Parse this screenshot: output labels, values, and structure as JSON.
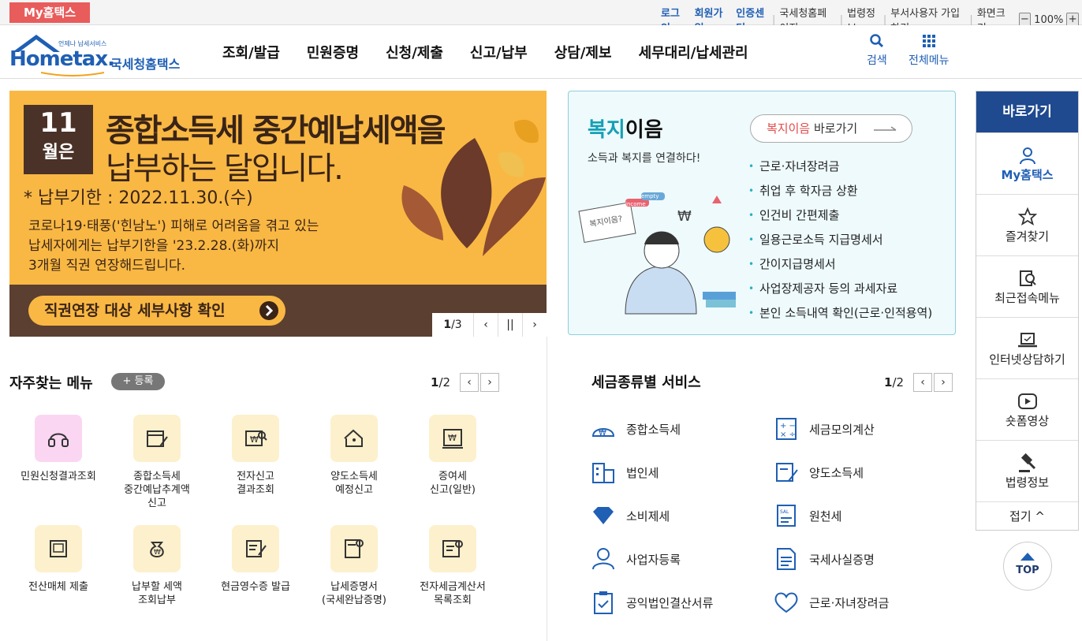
{
  "topbar": {
    "my_badge": "My홈택스",
    "links_blue": [
      "로그인",
      "회원가입",
      "인증센터"
    ],
    "links": [
      "국세청홈페이지",
      "법령정보",
      "부서사용자 가입하기"
    ],
    "zoom_label": "화면크기",
    "zoom_minus": "−",
    "zoom_value": "100%",
    "zoom_plus": "+"
  },
  "header": {
    "logo_small": "언제나 납세서비스",
    "logo_main": "Hometax.",
    "logo_kr": "국세청홈택스",
    "nav": [
      "조회/발급",
      "민원증명",
      "신청/제출",
      "신고/납부",
      "상담/제보",
      "세무대리/납세관리"
    ],
    "search_label": "검색",
    "allmenu_label": "전체메뉴"
  },
  "banner": {
    "month_num": "11",
    "month_suffix": "월은",
    "title_line1": "종합소득세 중간예납세액을",
    "title_line2": "납부하는 달입니다.",
    "due_date": "* 납부기한 : 2022.11.30.(수)",
    "desc_lines": [
      "코로나19·태풍('힌남노') 피해로 어려움을 겪고 있는",
      "납세자에게는 납부기한을 '23.2.28.(화)까지",
      "3개월 직권 연장해드립니다."
    ],
    "cta": "직권연장 대상 세부사항 확인",
    "page_current": "1",
    "page_total": "/3",
    "prev": "‹",
    "pause": "||",
    "next": "›"
  },
  "welfare": {
    "title_a": "복지",
    "title_b": "이음",
    "subtitle": "소득과 복지를 연결하다!",
    "go_a": "복지이음",
    "go_b": " 바로가기",
    "list": [
      "근로·자녀장려금",
      "취업 후 학자금 상환",
      "인건비 간편제출",
      "일용근로소득 지급명세서",
      "간이지급명세서",
      "사업장제공자 등의 과세자료",
      "본인 소득내역 확인(근로·인적용역)"
    ],
    "sign_text": "복지이음?",
    "tag1": "empty",
    "tag2": "income",
    "currency": "₩"
  },
  "favorites": {
    "title": "자주찾는 메뉴",
    "register": "+ 등록",
    "page_current": "1",
    "page_total": "/2",
    "items": [
      {
        "label": "민원신청결과조회"
      },
      {
        "label": "종합소득세\n중간예납추계액\n신고"
      },
      {
        "label": "전자신고\n결과조회"
      },
      {
        "label": "양도소득세\n예정신고"
      },
      {
        "label": "증여세\n신고(일반)"
      },
      {
        "label": "전산매체 제출"
      },
      {
        "label": "납부할 세액\n조회납부"
      },
      {
        "label": "현금영수증 발급"
      },
      {
        "label": "납세증명서\n(국세완납증명)"
      },
      {
        "label": "전자세금계산서\n목록조회"
      }
    ]
  },
  "taxservice": {
    "title": "세금종류별 서비스",
    "page_current": "1",
    "page_total": "/2",
    "items": [
      "종합소득세",
      "세금모의계산",
      "법인세",
      "양도소득세",
      "소비제세",
      "원천세",
      "사업자등록",
      "국세사실증명",
      "공익법인결산서류",
      "근로·자녀장려금"
    ]
  },
  "quick": {
    "title": "바로가기",
    "items": [
      "My홈택스",
      "즐겨찾기",
      "최근접속메뉴",
      "인터넷상담하기",
      "숏폼영상",
      "법령정보"
    ],
    "fold": "접기 ^",
    "top": "TOP"
  },
  "colors": {
    "accent": "#1f5fb4",
    "banner_bg": "#f9b843",
    "banner_dark": "#5b3f31",
    "welfare_bg": "#eefafc",
    "quick_head": "#1f4a8f",
    "badge": "#e95c5c"
  }
}
